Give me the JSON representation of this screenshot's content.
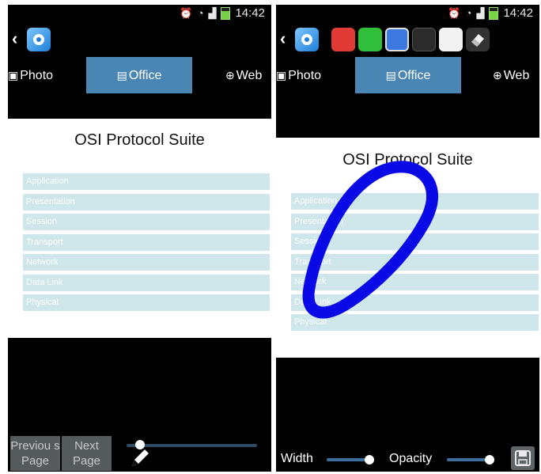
{
  "left_screen": {
    "status": {
      "time": "14:42"
    },
    "tabs": [
      "Photo",
      "Office",
      "Web"
    ],
    "document": {
      "title": "OSI Protocol Suite",
      "layers": [
        "Application",
        "Presentation",
        "Session",
        "Transport",
        "Network",
        "Data Link",
        "Physical"
      ]
    },
    "buttons": {
      "previous": "Previou s Page",
      "next": "Next Page"
    },
    "slider": {
      "value": 0.1
    }
  },
  "right_screen": {
    "status": {
      "time": "14:42"
    },
    "tabs": [
      "Photo",
      "Office",
      "Web"
    ],
    "colors": [
      "#e23b35",
      "#2fbf3b",
      "#3b78e0",
      "#2b2b2b",
      "#f2f2f2"
    ],
    "document": {
      "title": "OSI Protocol Suite",
      "layers": [
        "Application",
        "Presentation",
        "Session",
        "Transport",
        "Network",
        "Data Link",
        "Physical"
      ]
    },
    "controls": {
      "width_label": "Width",
      "opacity_label": "Opacity",
      "width_value": 0.9,
      "opacity_value": 0.9
    },
    "annotation_color": "#0a0ae6"
  }
}
